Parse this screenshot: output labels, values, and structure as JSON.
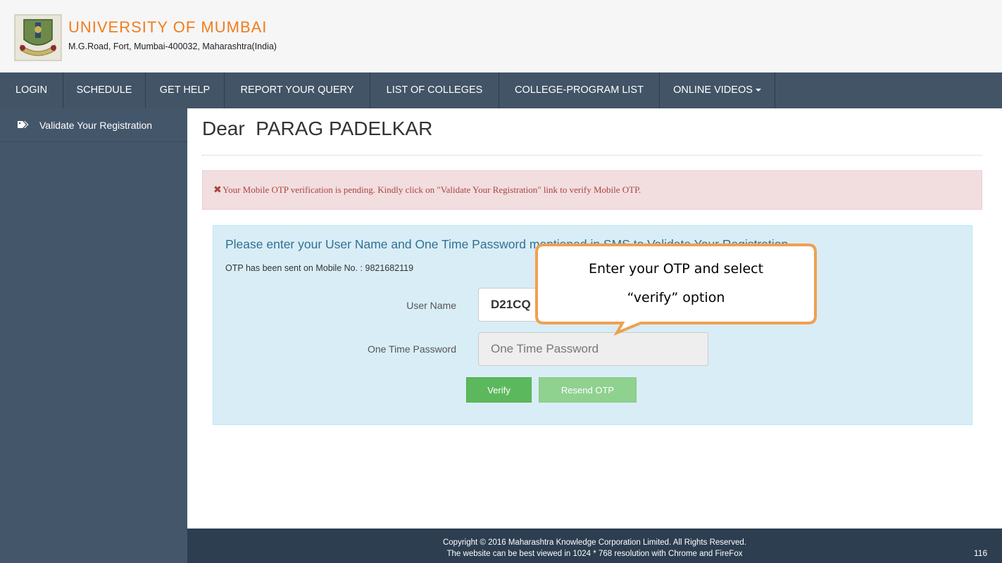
{
  "header": {
    "title": "UNIVERSITY OF MUMBAI",
    "address": "M.G.Road, Fort, Mumbai-400032, Maharashtra(India)",
    "logo_icon": "university-crest-logo"
  },
  "nav": {
    "items": [
      {
        "label": "LOGIN"
      },
      {
        "label": "SCHEDULE"
      },
      {
        "label": "GET HELP"
      },
      {
        "label": "REPORT YOUR QUERY"
      },
      {
        "label": "LIST OF COLLEGES"
      },
      {
        "label": "COLLEGE-PROGRAM LIST"
      },
      {
        "label": "ONLINE VIDEOS",
        "icon": "caret-down-icon"
      }
    ]
  },
  "sidebar": {
    "items": [
      {
        "label": "Validate Your Registration",
        "icon": "tags-icon"
      }
    ]
  },
  "main": {
    "greeting": "Dear  PARAG PADELKAR",
    "alert": {
      "icon": "close-x-icon",
      "text": "Your Mobile OTP verification is pending. Kindly click on \"Validate Your Registration\" link to verify Mobile OTP."
    },
    "panel": {
      "heading": "Please enter your User Name and One Time Password mentioned in SMS to Validate Your Registration",
      "otp_note": "OTP has been sent on Mobile No. : 9821682119",
      "username_label": "User Name",
      "username_value": "D21CQ",
      "otp_label": "One Time Password",
      "otp_placeholder": "One Time Password",
      "verify_label": "Verify",
      "resend_label": "Resend OTP"
    }
  },
  "callout": {
    "line1": "Enter your OTP and select",
    "line2": "“verify” option"
  },
  "footer": {
    "line1": "Copyright © 2016 Maharashtra Knowledge Corporation Limited. All Rights Reserved.",
    "line2": "The website can be best viewed in 1024 * 768 resolution with Chrome and FireFox"
  },
  "page_number": "116",
  "colors": {
    "brand_orange": "#f07d1f",
    "nav_bg": "#425466",
    "sidebar_bg": "#44566a",
    "alert_text": "#a94442",
    "panel_bg": "#d9edf7",
    "verify_green": "#5cb85c",
    "callout_border": "#f0a050",
    "footer_bg": "#2c3e50"
  }
}
